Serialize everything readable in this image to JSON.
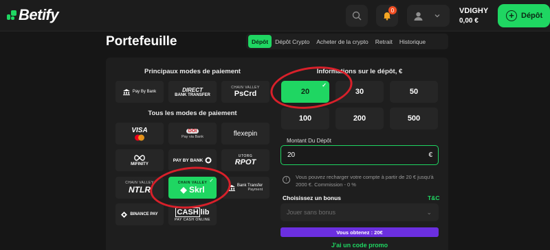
{
  "header": {
    "logo_text": "Betify",
    "notification_count": "0",
    "username": "VDIGHY",
    "balance": "0,00 €",
    "deposit_button": "Dépôt"
  },
  "page": {
    "title": "Portefeuille"
  },
  "tabs": [
    {
      "label": "Dépôt",
      "active": true
    },
    {
      "label": "Dépôt Crypto"
    },
    {
      "label": "Acheter de la crypto"
    },
    {
      "label": "Retrait"
    },
    {
      "label": "Historique"
    }
  ],
  "payment": {
    "main_title": "Principaux modes de paiement",
    "all_title": "Tous les modes de paiement",
    "main_methods": {
      "paybybank": "Pay By Bank",
      "direct_line1": "DIRECT",
      "direct_line2": "BANK TRANSFER",
      "chainvalley": "CHAIN VALLEY",
      "pscrd": "PsCrd"
    },
    "all_methods": {
      "visa": "VISA",
      "payvia_logo": "DOI",
      "payvia_sub": "Pay via Bank",
      "flexepin": "flexepin",
      "mifinity": "MIFINITY",
      "paybybank2": "PAY BY BANK",
      "utorg": "UTORG",
      "rpot": "RPOT",
      "chainvalley2": "CHAIN VALLEY",
      "ntlr": "NTLR",
      "chainvalley3": "CHAIN VALLEY",
      "skrl": "Skrl",
      "banktransfer_line1": "Bank Transfer",
      "banktransfer_line2": "Payment",
      "binance": "BINANCE PAY",
      "cashlib_a": "CASH",
      "cashlib_b": "lib",
      "cashlib_sub": "PAY CASH ONLINE"
    }
  },
  "deposit": {
    "title": "Informations sur le dépôt, €",
    "amounts": [
      "20",
      "30",
      "50",
      "100",
      "200",
      "500"
    ],
    "selected_amount": "20",
    "amount_label": "Montant Du Dépôt",
    "amount_value": "20",
    "currency": "€",
    "info": "Vous pouvez recharger votre compte à partir de 20 € jusqu'à 2000 €. Commission - 0 %",
    "bonus_label": "Choisissez un bonus",
    "tc": "T&C",
    "bonus_placeholder": "Jouer sans bonus",
    "win_text": "Vous obtenez : 20€",
    "promo": "J'ai un code promo"
  },
  "colors": {
    "accent": "#1fd662",
    "purple": "#6b2fe0",
    "annotation": "#d8202a"
  }
}
